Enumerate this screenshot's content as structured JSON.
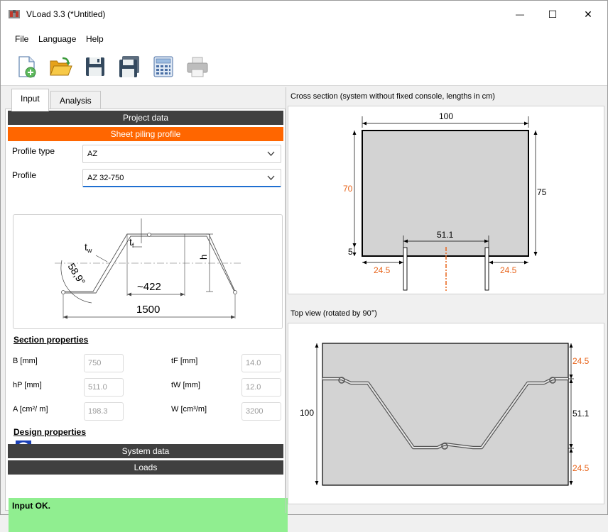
{
  "window": {
    "title": "VLoad 3.3 (*Untitled)",
    "minimize_glyph": "—",
    "maximize_glyph": "☐",
    "close_glyph": "✕"
  },
  "menu": {
    "items": [
      "File",
      "Language",
      "Help"
    ]
  },
  "toolbar": {
    "buttons": [
      "new-file-icon",
      "open-folder-icon",
      "save-icon",
      "save-as-icon",
      "calculator-icon",
      "print-icon"
    ]
  },
  "tabs": [
    {
      "label": "Input",
      "active": true
    },
    {
      "label": "Analysis",
      "active": false
    }
  ],
  "project": {
    "header": "Project data",
    "sheet_header": "Sheet piling profile",
    "profile_type_label": "Profile type",
    "profile_type_value": "AZ",
    "profile_label": "Profile",
    "profile_value": "AZ 32-750"
  },
  "profile_drawing": {
    "tw": "t",
    "tw_sub": "w",
    "tf": "t",
    "tf_sub": "f",
    "h": "h",
    "angle": "58,9°",
    "mid_width": "~422",
    "total_width": "1500"
  },
  "section_properties": {
    "title": "Section properties",
    "rows": [
      {
        "label": "B [mm]",
        "value": "750",
        "label2": "tF [mm]",
        "value2": "14.0"
      },
      {
        "label": "hP [mm]",
        "value": "511.0",
        "label2": "tW [mm]",
        "value2": "12.0"
      },
      {
        "label": "A [cm²/ m]",
        "value": "198.3",
        "label2": "W [cm³/m]",
        "value2": "3200"
      }
    ]
  },
  "design_properties": {
    "title": "Design properties",
    "icon": "info-icon"
  },
  "system_header": "System data",
  "loads_header": "Loads",
  "status": "Input OK.",
  "cross_section": {
    "title": "Cross section (system without fixed console, lengths in cm)",
    "top_width": "100",
    "left_height": "70",
    "right_height": "75",
    "bottom_small": "5",
    "console_width": "51.1",
    "left_offset": "24.5",
    "right_offset": "24.5"
  },
  "top_view": {
    "title": "Top view (rotated by 90°)",
    "left_length": "100",
    "top_offset": "24.5",
    "mid_length": "51.1",
    "bottom_offset": "24.5"
  },
  "colors": {
    "dark_bar": "#404040",
    "orange_bar": "#ff6600",
    "status_ok": "#90ee90",
    "dim_orange": "#e8651c",
    "focus_blue": "#1f6fd1"
  }
}
